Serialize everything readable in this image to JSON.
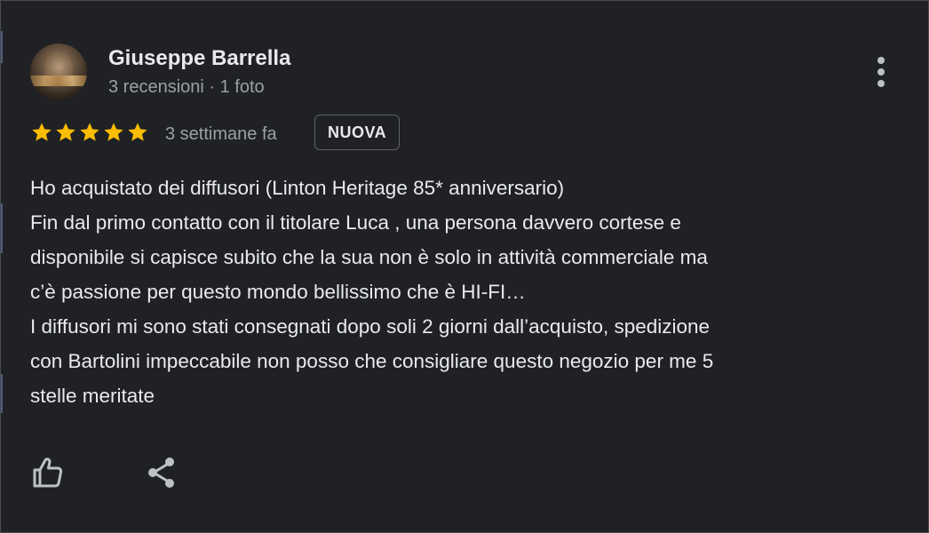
{
  "review": {
    "author": {
      "name": "Giuseppe Barrella",
      "meta": "3 recensioni · 1 foto"
    },
    "rating": 5,
    "time_ago": "3 settimane fa",
    "badge": "NUOVA",
    "text_lines": [
      "Ho acquistato dei diffusori (Linton Heritage 85* anniversario)",
      "Fin dal primo contatto con il titolare Luca , una persona davvero cortese e",
      "disponibile si capisce subito che la sua non è solo in attività commerciale ma",
      "c’è passione per questo mondo bellissimo che è HI-FI…",
      "I diffusori mi sono stati consegnati dopo soli 2 giorni dall’acquisto, spedizione",
      "con Bartolini impeccabile non posso che consigliare questo negozio per me 5",
      "stelle meritate"
    ]
  },
  "icons": {
    "more": "more-vert-icon",
    "star": "star-icon",
    "like": "thumb-up-icon",
    "share": "share-icon"
  },
  "colors": {
    "background": "#202124",
    "star": "#fbbc04",
    "text": "#e8eaed",
    "secondary_text": "#9aa0a6"
  }
}
